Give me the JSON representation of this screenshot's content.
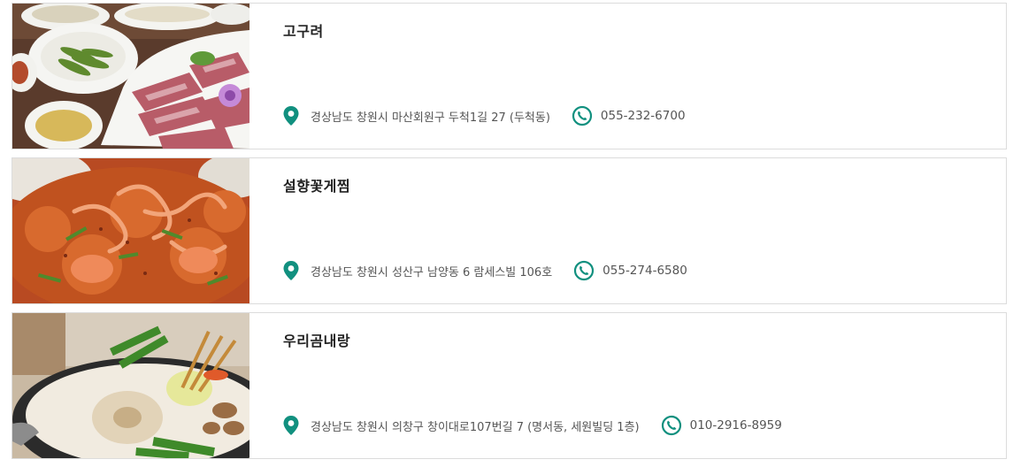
{
  "accent_color": "#11907f",
  "restaurants": [
    {
      "name": "고구려",
      "address": "경상남도 창원시 마산회원구 두척1길 27 (두척동)",
      "phone": "055-232-6700",
      "photo_icon": "grilled-beef-photo"
    },
    {
      "name": "설향꽃게찜",
      "address": "경상남도 창원시 성산구 남양동 6 람세스빌 106호",
      "phone": "055-274-6580",
      "photo_icon": "braised-crab-photo"
    },
    {
      "name": "우리곰내랑",
      "address": "경상남도 창원시 의창구 창이대로107번길 7 (명서동, 세원빌딩 1층)",
      "phone": "010-2916-8959",
      "photo_icon": "beef-hotpot-photo"
    }
  ]
}
